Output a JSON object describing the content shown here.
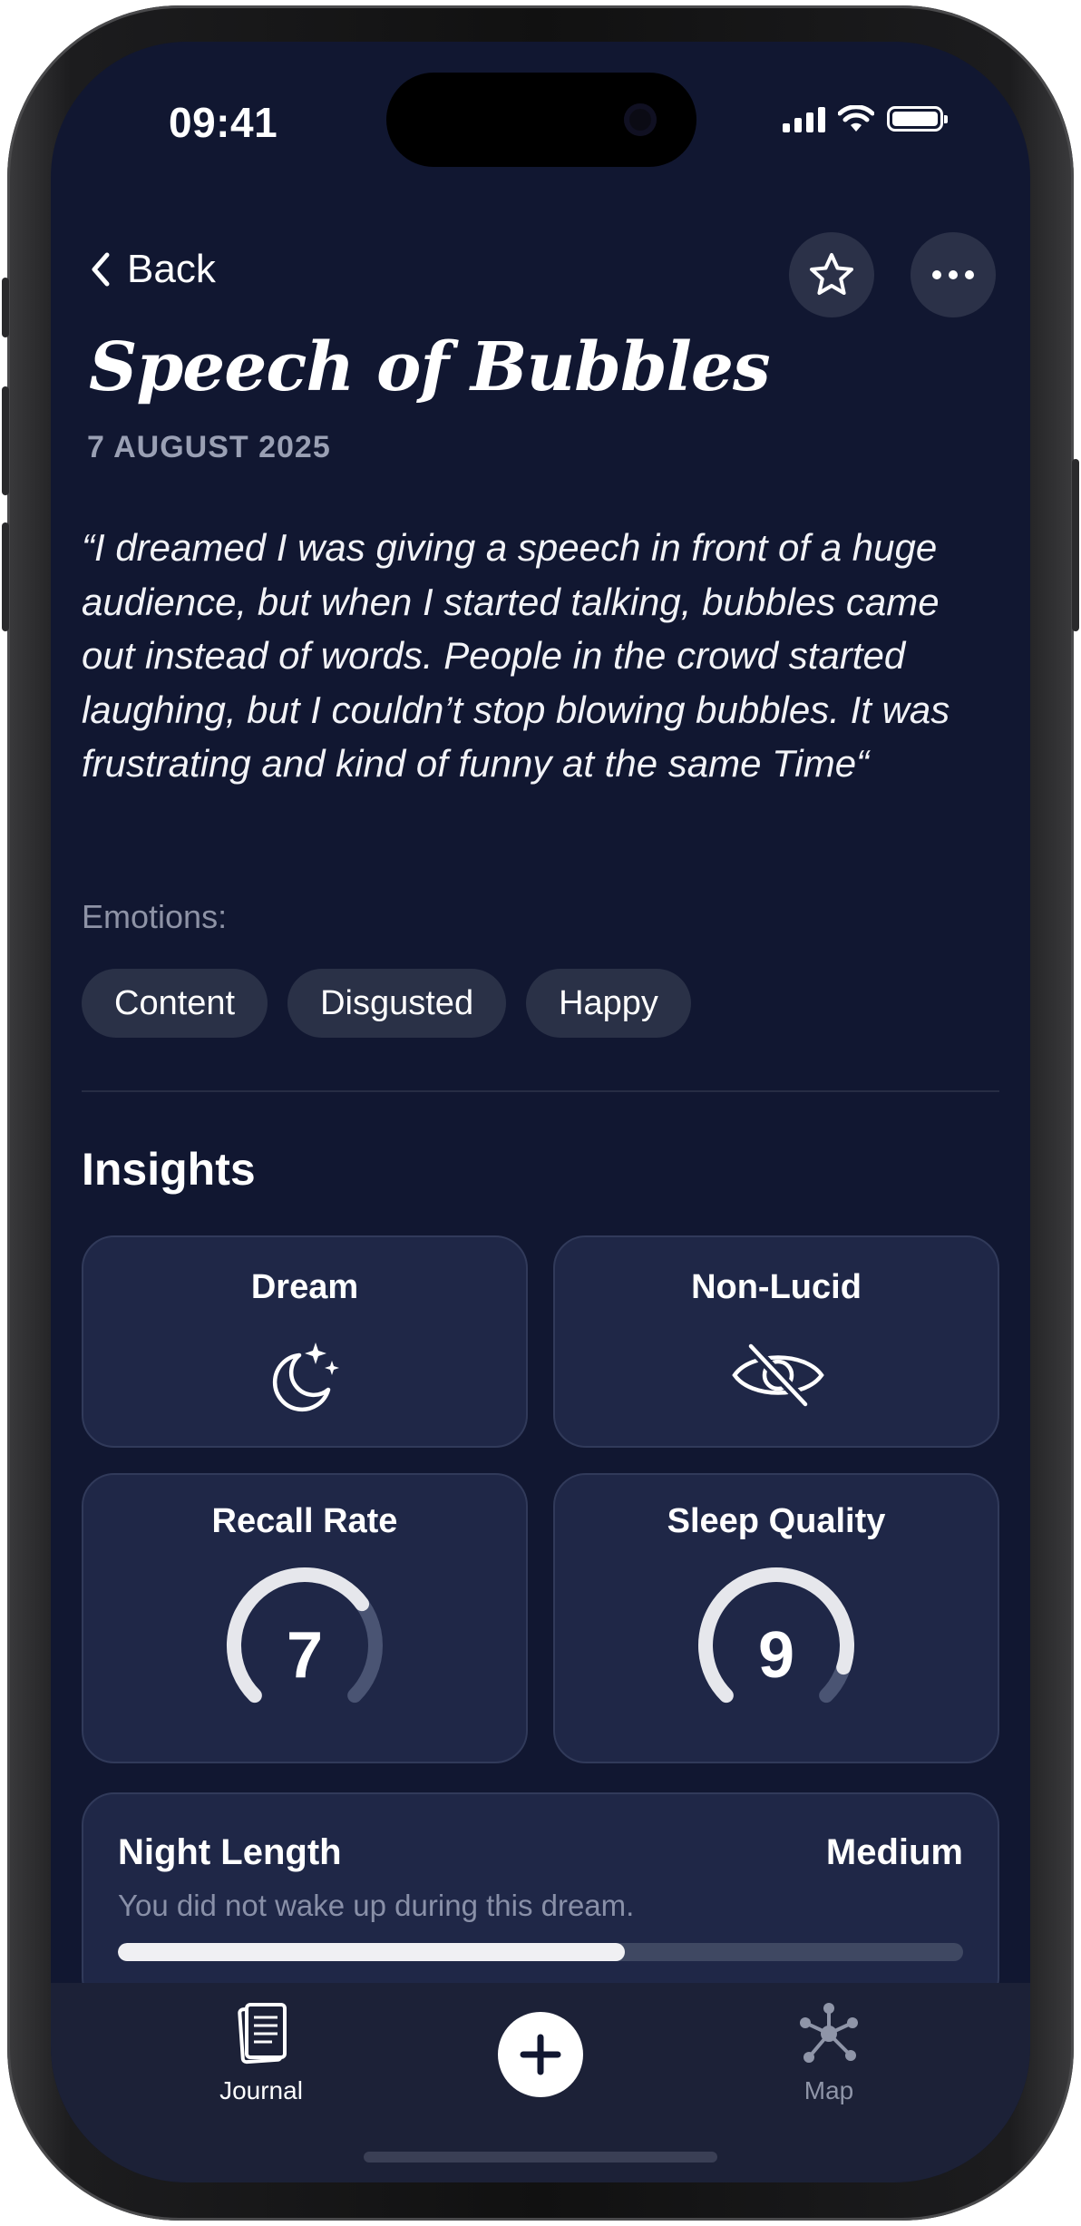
{
  "status_bar": {
    "time": "09:41"
  },
  "nav": {
    "back_label": "Back",
    "favorite_icon": "star-icon",
    "more_icon": "ellipsis-icon"
  },
  "entry": {
    "title": "Speech of Bubbles",
    "date": "7 AUGUST 2025",
    "quote": "“I dreamed I was giving a speech in front of a huge audience, but when I started talking, bubbles came out instead of words. People in the crowd started laughing, but I couldn’t stop blowing bubbles. It was frustrating and kind of funny at the same Time“",
    "emotions_label": "Emotions:",
    "emotions": [
      "Content",
      "Disgusted",
      "Happy"
    ]
  },
  "insights": {
    "heading": "Insights",
    "type_card": {
      "label": "Dream",
      "icon": "moon-stars-icon"
    },
    "lucid_card": {
      "label": "Non-Lucid",
      "icon": "eye-slash-icon"
    },
    "recall": {
      "label": "Recall Rate",
      "value": "7",
      "max": 10
    },
    "sleep": {
      "label": "Sleep Quality",
      "value": "9",
      "max": 10
    },
    "night_length": {
      "label": "Night Length",
      "value": "Medium",
      "description": "You did not wake up during this dream.",
      "progress": 0.6
    }
  },
  "tab_bar": {
    "journal_label": "Journal",
    "map_label": "Map",
    "add_icon": "plus-icon"
  },
  "colors": {
    "background": "#111731",
    "card": "#1f2747",
    "chip": "#2a3147",
    "muted_text": "#8e93a6"
  }
}
